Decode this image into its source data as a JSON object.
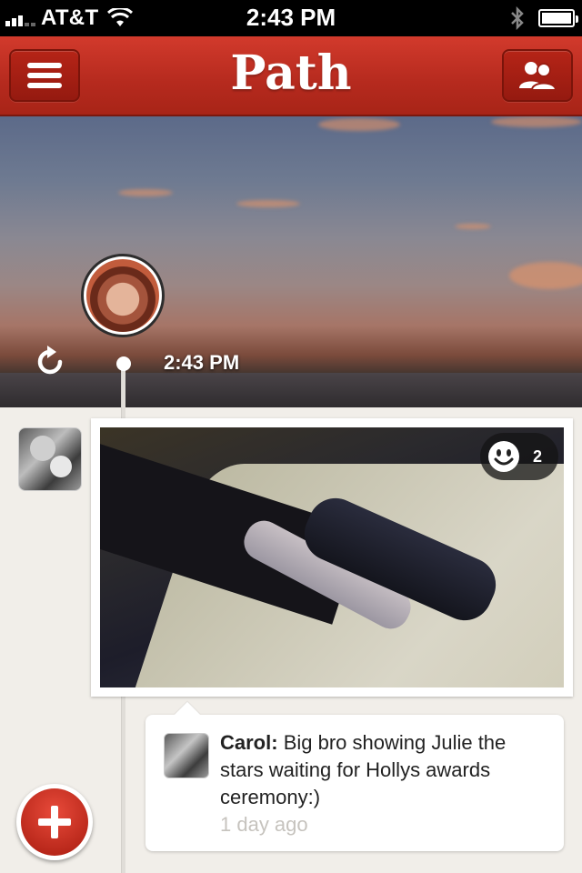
{
  "status_bar": {
    "carrier": "AT&T",
    "time": "2:43 PM",
    "icons": [
      "signal-icon",
      "wifi-icon",
      "bluetooth-icon",
      "battery-icon"
    ]
  },
  "nav": {
    "title": "Path",
    "left_icon": "menu-icon",
    "right_icon": "friends-icon"
  },
  "cover": {
    "time": "2:43 PM",
    "icons": [
      "refresh-icon"
    ]
  },
  "post": {
    "likes_count": "2",
    "likes_icon": "smile-icon"
  },
  "comment": {
    "author": "Carol:",
    "text": "Big bro showing Julie the stars waiting for Hollys awards ceremony:)",
    "time": "1 day ago"
  },
  "colors": {
    "accent": "#c2301f",
    "background": "#f1eee9"
  }
}
